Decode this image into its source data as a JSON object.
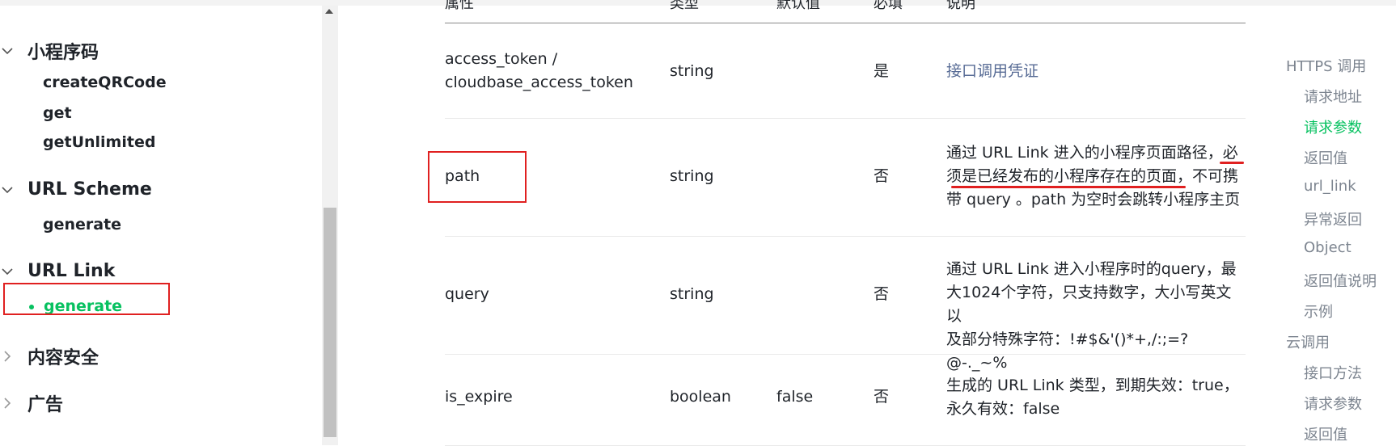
{
  "sidebar": {
    "groups": [
      {
        "title": "小程序码",
        "expanded": true,
        "items": [
          "createQRCode",
          "get",
          "getUnlimited"
        ]
      },
      {
        "title": "URL Scheme",
        "expanded": true,
        "items": [
          "generate"
        ]
      },
      {
        "title": "URL Link",
        "expanded": true,
        "items": [
          "generate"
        ],
        "active_item": "generate"
      },
      {
        "title": "内容安全",
        "expanded": false
      },
      {
        "title": "广告",
        "expanded": false
      }
    ]
  },
  "table": {
    "headers": [
      "属性",
      "类型",
      "默认值",
      "必填",
      "说明"
    ],
    "rows": [
      {
        "name_line1": "access_token /",
        "name_line2": "cloudbase_access_token",
        "type": "string",
        "default": "",
        "required": "是",
        "desc": "接口调用凭证"
      },
      {
        "name": "path",
        "type": "string",
        "default": "",
        "required": "否",
        "desc_line1": "通过 URL Link 进入的小程序页面路径，必",
        "desc_line2": "须是已经发布的小程序存在的页面，不可携",
        "desc_line3": "带 query 。path 为空时会跳转小程序主页"
      },
      {
        "name": "query",
        "type": "string",
        "default": "",
        "required": "否",
        "desc_line1": "通过 URL Link 进入小程序时的query，最",
        "desc_line2": "大1024个字符，只支持数字，大小写英文以",
        "desc_line3": "及部分特殊字符：!#$&'()*+,/:;=?@-._~%"
      },
      {
        "name": "is_expire",
        "type": "boolean",
        "default": "false",
        "required": "否",
        "desc_line1": "生成的 URL Link 类型，到期失效：true，",
        "desc_line2": "永久有效：false"
      }
    ]
  },
  "toc": {
    "items": [
      {
        "label": "HTTPS 调用",
        "level": 1
      },
      {
        "label": "请求地址",
        "level": 2
      },
      {
        "label": "请求参数",
        "level": 2,
        "active": true
      },
      {
        "label": "返回值",
        "level": 2
      },
      {
        "label": "url_link",
        "level": 2
      },
      {
        "label": "异常返回",
        "level": 2
      },
      {
        "label": "Object",
        "level": 2
      },
      {
        "label": "返回值说明",
        "level": 2
      },
      {
        "label": "示例",
        "level": 2
      },
      {
        "label": "云调用",
        "level": 1
      },
      {
        "label": "接口方法",
        "level": 2
      },
      {
        "label": "请求参数",
        "level": 2
      },
      {
        "label": "返回值",
        "level": 2
      }
    ]
  },
  "colors": {
    "accent": "#07c160",
    "link": "#576b95",
    "annotation": "#e02020"
  }
}
